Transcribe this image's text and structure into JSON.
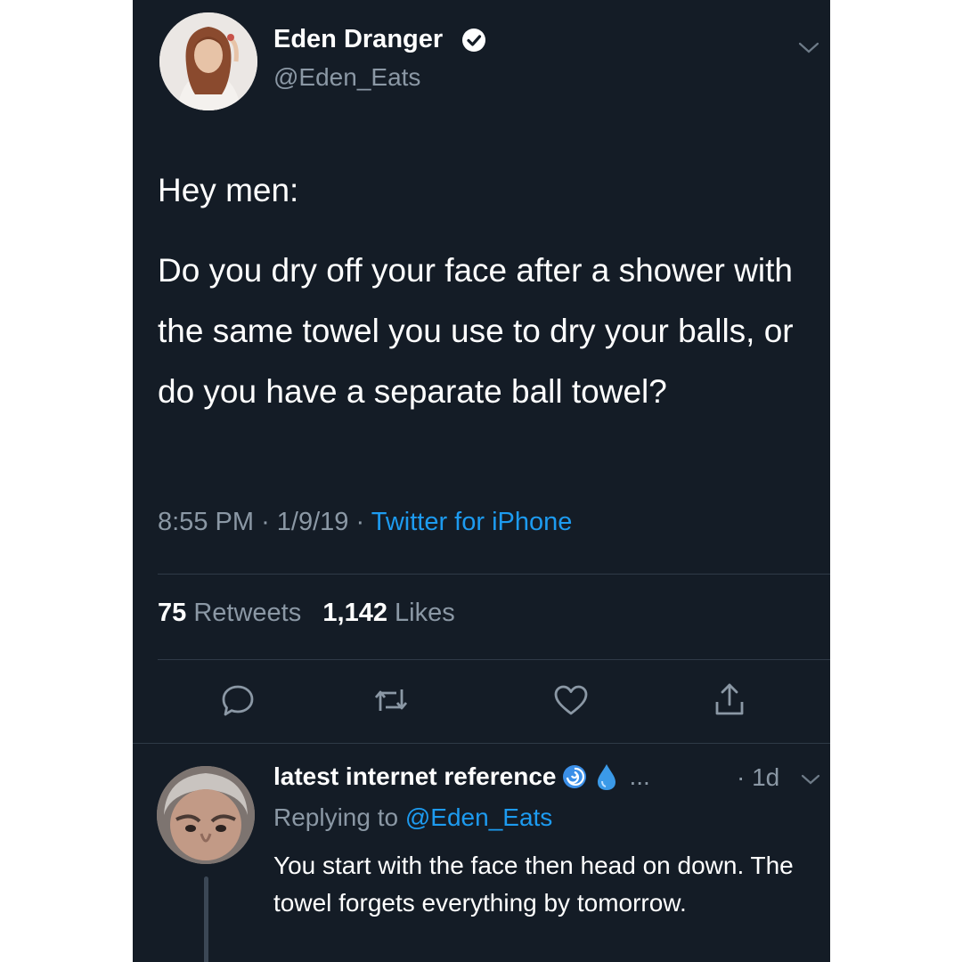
{
  "tweet": {
    "author": {
      "name": "Eden Dranger",
      "handle": "@Eden_Eats",
      "verified": true
    },
    "text_lines": [
      "Hey men:",
      "Do you dry off your face after a shower with the same towel you use to dry your balls, or do you have a separate ball towel?"
    ],
    "time": "8:55 PM",
    "date": "1/9/19",
    "separator": "·",
    "source": "Twitter for iPhone",
    "retweets_count": "75",
    "retweets_label": "Retweets",
    "likes_count": "1,142",
    "likes_label": "Likes",
    "actions": [
      "reply-icon",
      "retweet-icon",
      "like-icon",
      "share-icon"
    ]
  },
  "reply": {
    "author_name": "latest internet reference",
    "ellipsis": "...",
    "time": "· 1d",
    "replying_prefix": "Replying to",
    "replying_to": "@Eden_Eats",
    "text": "You start with the face then head on down. The towel forgets everything by tomorrow."
  },
  "colors": {
    "background": "#141c26",
    "text": "#ffffff",
    "secondary": "#8b98a5",
    "accent": "#1d9bf0"
  }
}
